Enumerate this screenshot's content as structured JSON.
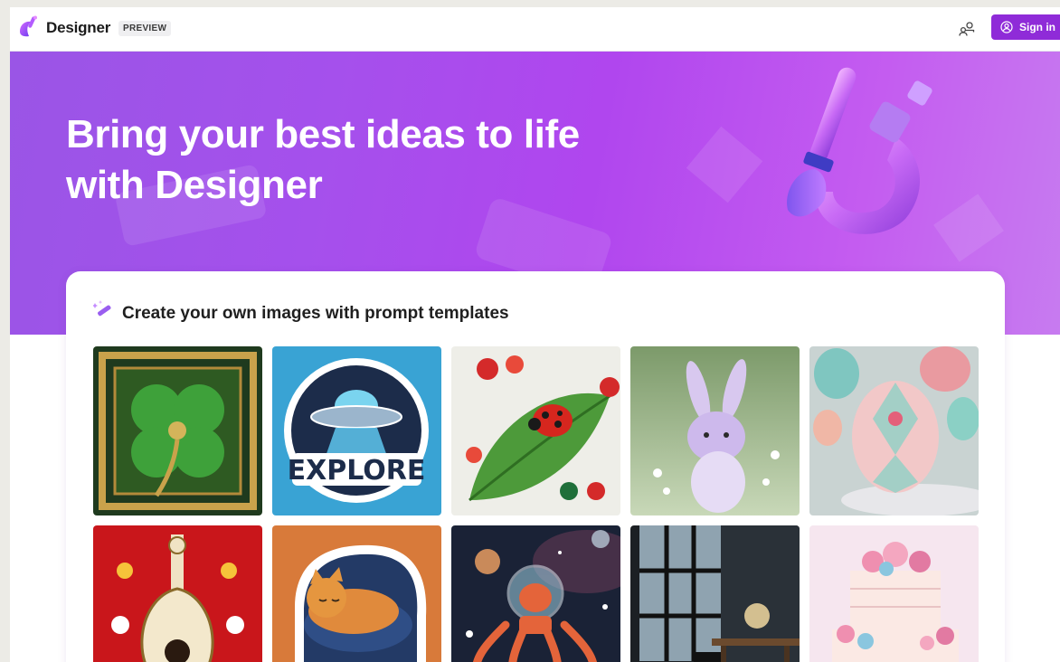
{
  "topbar": {
    "brand": "Designer",
    "badge": "PREVIEW",
    "signin_label": "Sign in"
  },
  "hero": {
    "title_line1": "Bring your best ideas to life",
    "title_line2": "with Designer"
  },
  "templates": {
    "heading": "Create your own images with prompt templates",
    "tiles": [
      {
        "subject": "clover-tile"
      },
      {
        "subject": "explore-badge",
        "text": "EXPLORE"
      },
      {
        "subject": "ladybug-quilling"
      },
      {
        "subject": "bunny"
      },
      {
        "subject": "easter-egg"
      },
      {
        "subject": "folk-instrument"
      },
      {
        "subject": "sleeping-cat"
      },
      {
        "subject": "space-octopus"
      },
      {
        "subject": "desk-window"
      },
      {
        "subject": "flower-cake"
      }
    ]
  },
  "colors": {
    "accent": "#8f2bd8",
    "hero_start": "#9a55e6",
    "hero_end": "#c77bf0"
  }
}
